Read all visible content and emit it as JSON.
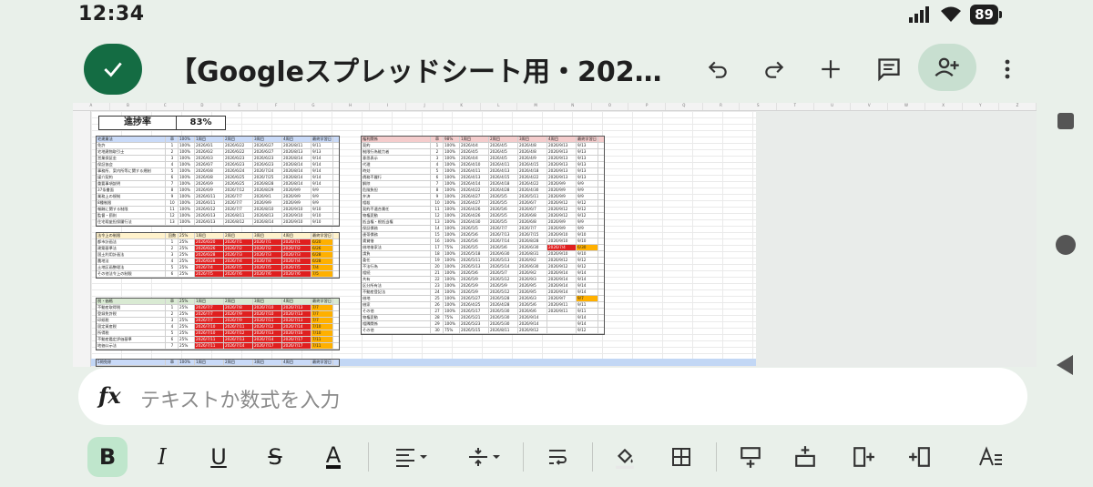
{
  "status_bar": {
    "time": "12:34",
    "battery": "89"
  },
  "app_bar": {
    "title": "【Googleスプレッドシート用・202…"
  },
  "sheet": {
    "progress_label": "進捗率",
    "progress_value": "83%",
    "left_tables": [
      {
        "color": "blue",
        "header": [
          "宅建業法",
          "章",
          "100%",
          "1周目",
          "2周目",
          "3周目",
          "4周目",
          "最終学習日"
        ],
        "rows": [
          [
            "免許",
            "1",
            "100%",
            "2026/6/1",
            "2026/6/22",
            "2026/6/27",
            "2026/8/11",
            "9/11"
          ],
          [
            "宅地建物取引士",
            "2",
            "100%",
            "2026/6/2",
            "2026/6/22",
            "2026/6/27",
            "2026/8/13",
            "9/13"
          ],
          [
            "営業保証金",
            "3",
            "100%",
            "2026/6/3",
            "2026/6/23",
            "2026/6/23",
            "2026/8/14",
            "9/14"
          ],
          [
            "保証協会",
            "4",
            "100%",
            "2026/6/7",
            "2026/6/23",
            "2026/6/23",
            "2026/8/14",
            "9/14"
          ],
          [
            "事務所、案内所等に関する規制",
            "5",
            "100%",
            "2026/6/8",
            "2026/6/24",
            "2026/7/24",
            "2026/8/14",
            "9/14"
          ],
          [
            "媒介契約",
            "6",
            "100%",
            "2026/6/8",
            "2026/6/25",
            "2026/7/25",
            "2026/8/14",
            "9/14"
          ],
          [
            "重要事項説明",
            "7",
            "100%",
            "2026/6/9",
            "2026/6/25",
            "2026/8/28",
            "2026/8/14",
            "9/14"
          ],
          [
            "37条書面",
            "8",
            "100%",
            "2026/6/9",
            "2026/7/12",
            "2026/8/29",
            "2026/9/9",
            "9/9"
          ],
          [
            "業務上の規制",
            "9",
            "100%",
            "2026/6/11",
            "2026/7/7",
            "2026/9/1",
            "2026/9/9",
            "9/9"
          ],
          [
            "8種制限",
            "10",
            "100%",
            "2026/6/11",
            "2026/7/7",
            "2026/9/9",
            "2026/9/9",
            "9/9"
          ],
          [
            "報酬に関する制限",
            "11",
            "100%",
            "2026/6/12",
            "2026/7/7",
            "2026/8/10",
            "2026/9/10",
            "9/10"
          ],
          [
            "監督・罰則",
            "12",
            "100%",
            "2026/6/13",
            "2026/8/11",
            "2026/8/13",
            "2026/9/10",
            "9/10"
          ],
          [
            "住宅瑕疵担保履行法",
            "13",
            "100%",
            "2026/6/13",
            "2026/8/12",
            "2026/8/14",
            "2026/9/10",
            "9/10"
          ]
        ]
      },
      {
        "color": "yellow",
        "header": [
          "法令上の制限",
          "回数",
          "25%",
          "1周目",
          "2周目",
          "3周目",
          "4周目",
          "最終学習日"
        ],
        "rows": [
          [
            "都市計画法",
            "1",
            "25%",
            "2026/6/20",
            "2026/7/1",
            "2026/7/1",
            "2026/7/1",
            "6/20"
          ],
          [
            "建築基準法",
            "2",
            "25%",
            "2026/6/26",
            "2026/7/2",
            "2026/7/2",
            "2026/7/2",
            "6/26"
          ],
          [
            "国土利用計画法",
            "3",
            "25%",
            "2026/6/28",
            "2026/7/3",
            "2026/7/3",
            "2026/7/3",
            "6/28"
          ],
          [
            "農地法",
            "4",
            "25%",
            "2026/6/28",
            "2026/7/4",
            "2026/7/4",
            "2026/7/4",
            "6/28"
          ],
          [
            "土地区画整理法",
            "5",
            "25%",
            "2026/7/4",
            "2026/7/5",
            "2026/7/5",
            "2026/7/5",
            "7/4"
          ],
          [
            "その他法令上の制限",
            "6",
            "25%",
            "2026/7/5",
            "2026/7/6",
            "2026/7/6",
            "2026/7/6",
            "7/5"
          ]
        ]
      },
      {
        "color": "green",
        "header": [
          "税・価格",
          "章",
          "25%",
          "1周目",
          "2周目",
          "3周目",
          "4周目",
          "最終学習日"
        ],
        "rows": [
          [
            "不動産取得税",
            "1",
            "25%",
            "2026/7/7",
            "2026/7/8",
            "2026/7/10",
            "2026/7/13",
            "7/7"
          ],
          [
            "登録免許税",
            "2",
            "25%",
            "2026/7/7",
            "2026/7/9",
            "2026/7/10",
            "2026/7/13",
            "7/7"
          ],
          [
            "印紙税",
            "3",
            "25%",
            "2026/7/7",
            "2026/7/9",
            "2026/7/11",
            "2026/7/13",
            "7/7"
          ],
          [
            "固定資産税",
            "4",
            "25%",
            "2026/7/10",
            "2026/7/11",
            "2026/7/12",
            "2026/7/14",
            "7/10"
          ],
          [
            "所得税",
            "5",
            "25%",
            "2026/7/10",
            "2026/7/12",
            "2026/7/13",
            "2026/7/16",
            "7/10"
          ],
          [
            "不動産鑑定評価基準",
            "6",
            "25%",
            "2026/7/11",
            "2026/7/13",
            "2026/7/14",
            "2026/7/17",
            "7/11"
          ],
          [
            "地価公示法",
            "7",
            "25%",
            "2026/7/11",
            "2026/7/14",
            "2026/7/17",
            "2026/7/17",
            "7/11"
          ]
        ]
      }
    ],
    "right_table": {
      "header": [
        "権利関係",
        "章",
        "98%",
        "1周目",
        "2周目",
        "3周目",
        "4周目",
        "最終学習日"
      ],
      "rows": [
        [
          "契約",
          "1",
          "100%",
          "2026/4/4",
          "2026/4/5",
          "2026/4/8",
          "2026/9/13",
          "9/13"
        ],
        [
          "制限行為能力者",
          "2",
          "100%",
          "2026/4/5",
          "2026/4/5",
          "2026/4/8",
          "2026/9/13",
          "9/13"
        ],
        [
          "意思表示",
          "3",
          "100%",
          "2026/4/4",
          "2026/4/5",
          "2026/4/9",
          "2026/9/13",
          "9/13"
        ],
        [
          "代理",
          "4",
          "100%",
          "2026/4/10",
          "2026/4/11",
          "2026/4/15",
          "2026/9/13",
          "9/13"
        ],
        [
          "時効",
          "5",
          "100%",
          "2026/4/11",
          "2026/4/13",
          "2026/4/18",
          "2026/9/13",
          "9/13"
        ],
        [
          "債務不履行",
          "6",
          "100%",
          "2026/4/13",
          "2026/4/15",
          "2026/4/22",
          "2026/9/13",
          "9/13"
        ],
        [
          "解除",
          "7",
          "100%",
          "2026/4/14",
          "2026/4/18",
          "2026/4/22",
          "2026/9/9",
          "9/9"
        ],
        [
          "危険負担",
          "8",
          "100%",
          "2026/4/22",
          "2026/4/28",
          "2026/4/30",
          "2026/9/9",
          "9/9"
        ],
        [
          "弁済",
          "9",
          "100%",
          "2026/4/27",
          "2026/5/5",
          "2026/5/11",
          "2026/9/9",
          "9/9"
        ],
        [
          "相殺",
          "10",
          "100%",
          "2026/4/27",
          "2026/5/5",
          "2026/6/7",
          "2026/9/12",
          "9/12"
        ],
        [
          "契約不適合責任",
          "11",
          "100%",
          "2026/4/26",
          "2026/5/6",
          "2026/6/7",
          "2026/9/12",
          "9/12"
        ],
        [
          "物権変動",
          "12",
          "100%",
          "2026/4/26",
          "2026/5/5",
          "2026/6/8",
          "2026/9/12",
          "9/12"
        ],
        [
          "抵当権・根抵当権",
          "13",
          "100%",
          "2026/4/30",
          "2026/5/5",
          "2026/6/8",
          "2026/9/9",
          "9/9"
        ],
        [
          "保証債務",
          "14",
          "100%",
          "2026/5/5",
          "2026/7/7",
          "2026/7/7",
          "2026/9/9",
          "9/9"
        ],
        [
          "連帯債務",
          "15",
          "100%",
          "2026/5/6",
          "2026/7/13",
          "2026/7/15",
          "2026/9/10",
          "9/10"
        ],
        [
          "賃貸借",
          "16",
          "100%",
          "2026/5/6",
          "2026/7/14",
          "2026/8/28",
          "2026/9/10",
          "9/10"
        ],
        [
          "借地借家法",
          "17",
          "75%",
          "2026/5/5",
          "2026/5/6",
          "2026/6/30",
          "2026/7/4",
          "6/30"
        ],
        [
          "請負",
          "18",
          "100%",
          "2026/5/18",
          "2026/6/30",
          "2026/8/31",
          "2026/9/10",
          "9/10"
        ],
        [
          "委任",
          "19",
          "100%",
          "2026/5/11",
          "2026/5/13",
          "2026/9/2",
          "2026/9/12",
          "9/12"
        ],
        [
          "不法行為",
          "20",
          "100%",
          "2026/5/13",
          "2026/5/14",
          "2026/6/30",
          "2026/9/12",
          "9/12"
        ],
        [
          "相続",
          "21",
          "100%",
          "2026/5/6",
          "2026/5/7",
          "2026/9/2",
          "2026/9/14",
          "9/14"
        ],
        [
          "共有",
          "22",
          "100%",
          "2026/5/9",
          "2026/5/12",
          "2026/9/3",
          "2026/9/14",
          "9/14"
        ],
        [
          "区分所有法",
          "23",
          "100%",
          "2026/5/9",
          "2026/5/9",
          "2026/9/5",
          "2026/9/14",
          "9/14"
        ],
        [
          "不動産登記法",
          "24",
          "100%",
          "2026/5/9",
          "2026/5/12",
          "2026/9/5",
          "2026/9/14",
          "9/14"
        ],
        [
          "借地",
          "25",
          "100%",
          "2026/5/27",
          "2026/5/28",
          "2026/6/3",
          "2026/9/7",
          "9/7"
        ],
        [
          "借家",
          "26",
          "100%",
          "2026/4/25",
          "2026/4/28",
          "2026/5/6",
          "2026/9/11",
          "9/11"
        ],
        [
          "その他",
          "27",
          "100%",
          "2026/5/17",
          "2026/5/30",
          "2026/6/6",
          "2026/9/11",
          "9/11"
        ],
        [
          "物権変動",
          "28",
          "75%",
          "2026/5/21",
          "2026/5/30",
          "2026/9/14",
          "",
          "9/14"
        ],
        [
          "相隣関係",
          "29",
          "100%",
          "2026/5/23",
          "2026/5/30",
          "2026/9/14",
          "",
          "9/14"
        ],
        [
          "その他",
          "30",
          "75%",
          "2026/5/15",
          "2026/8/11",
          "2026/9/12",
          "",
          "9/12"
        ]
      ]
    },
    "bottom_row_header": [
      "5問免除",
      "章",
      "100%",
      "1周目",
      "2周目",
      "3周目",
      "4周目",
      "最終学習日"
    ]
  },
  "formula_bar": {
    "fx_label": "fx",
    "placeholder": "テキストか数式を入力"
  },
  "toolbar": {
    "bold": "B",
    "italic": "I",
    "underline": "U",
    "strike": "S",
    "textcolor": "A"
  }
}
